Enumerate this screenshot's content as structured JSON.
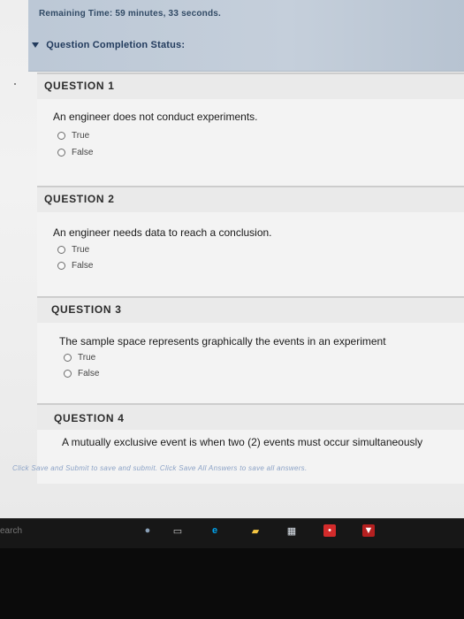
{
  "header": {
    "remaining_time": "Remaining Time: 59 minutes, 33 seconds.",
    "completion_status": "Question Completion Status:"
  },
  "questions": [
    {
      "title": "QUESTION 1",
      "text": "An engineer does not conduct experiments.",
      "options": [
        "True",
        "False"
      ]
    },
    {
      "title": "QUESTION 2",
      "text": "An engineer needs data to reach a conclusion.",
      "options": [
        "True",
        "False"
      ]
    },
    {
      "title": "QUESTION 3",
      "text": "The sample space represents graphically the events in an experiment",
      "options": [
        "True",
        "False"
      ]
    },
    {
      "title": "QUESTION 4",
      "text": "A mutually exclusive event is when two (2) events must occur simultaneously"
    }
  ],
  "footer_hint": "Click Save and Submit to save and submit. Click Save All Answers to save all answers.",
  "taskbar": {
    "search_text": "earch",
    "icons": [
      "microphone-icon",
      "task-view-icon",
      "edge-icon",
      "file-explorer-icon",
      "store-icon",
      "red-app-icon",
      "shield-icon"
    ]
  },
  "colors": {
    "header_background": "#c5cfdb",
    "header_text": "#223b5d",
    "hint_text": "#8ba2c6",
    "taskbar": "#171717"
  }
}
